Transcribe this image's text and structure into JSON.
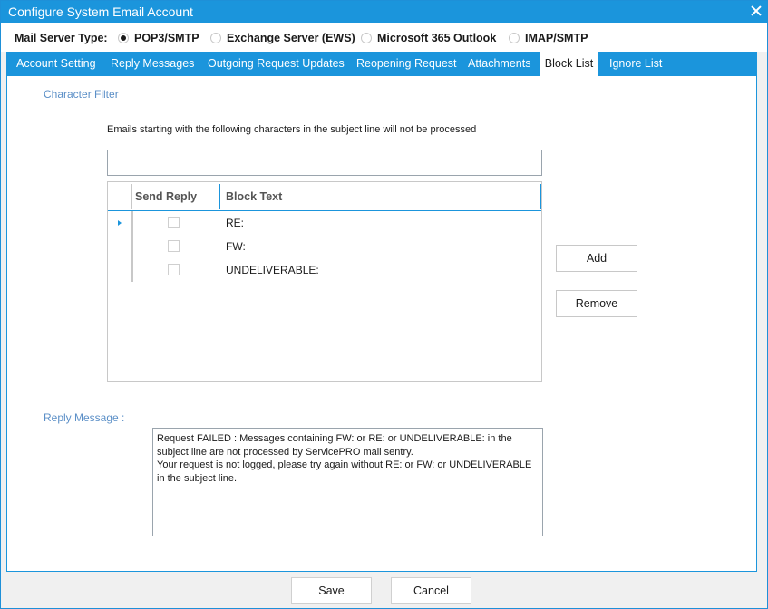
{
  "window": {
    "title": "Configure System Email Account"
  },
  "server_type": {
    "label": "Mail Server Type:",
    "options": [
      {
        "label": "POP3/SMTP",
        "selected": true
      },
      {
        "label": "Exchange Server (EWS)",
        "selected": false
      },
      {
        "label": "Microsoft 365 Outlook",
        "selected": false
      },
      {
        "label": "IMAP/SMTP",
        "selected": false
      }
    ]
  },
  "tabs": [
    {
      "label": "Account Setting"
    },
    {
      "label": "Reply Messages"
    },
    {
      "label": "Outgoing Request Updates"
    },
    {
      "label": "Reopening Request"
    },
    {
      "label": "Attachments"
    },
    {
      "label": "Block List",
      "active": true
    },
    {
      "label": "Ignore List"
    }
  ],
  "block_list": {
    "section_title": "Character Filter",
    "hint": "Emails starting with the following characters in the subject line will not be processed",
    "filter_input": {
      "value": "",
      "placeholder": ""
    },
    "columns": {
      "send_reply": "Send Reply",
      "block_text": "Block Text"
    },
    "rows": [
      {
        "send_reply": false,
        "block_text": "RE:"
      },
      {
        "send_reply": false,
        "block_text": "FW:"
      },
      {
        "send_reply": false,
        "block_text": "UNDELIVERABLE:"
      }
    ],
    "add_label": "Add",
    "remove_label": "Remove",
    "reply_label": "Reply Message :",
    "reply_text": "Request FAILED : Messages containing FW: or RE: or UNDELIVERABLE: in the subject line are not processed by ServicePRO mail sentry.\nYour request is not logged, please try again without RE: or FW: or UNDELIVERABLE in the subject line."
  },
  "footer": {
    "save_label": "Save",
    "cancel_label": "Cancel"
  },
  "colors": {
    "accent": "#1b95dc",
    "section_label": "#5b8fc7"
  }
}
